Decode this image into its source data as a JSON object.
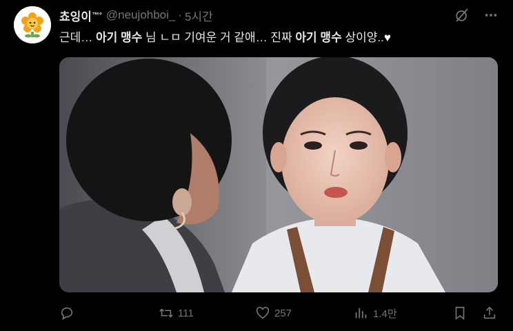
{
  "author": {
    "display_name": "쵸잉이",
    "badge": "™°",
    "handle": "@neujohboi_",
    "separator": "·",
    "time": "5시간"
  },
  "tweet": {
    "parts": [
      "근데… ",
      "아기 맹수",
      " 님 ㄴㅁ 기여운 거 같애… 진짜 ",
      "아기 맹수",
      " 상이양..",
      "♥"
    ]
  },
  "top_actions": {
    "grok_icon": "grok-icon",
    "more_icon": "more-icon"
  },
  "stats": {
    "replies": "",
    "retweets": "111",
    "likes": "257",
    "views": "1.4만"
  },
  "colors": {
    "background": "#000000",
    "text": "#e7e9ea",
    "muted": "#71767b",
    "avatar_bg": "#ffffff",
    "avatar_flower": "#f5a31a"
  }
}
